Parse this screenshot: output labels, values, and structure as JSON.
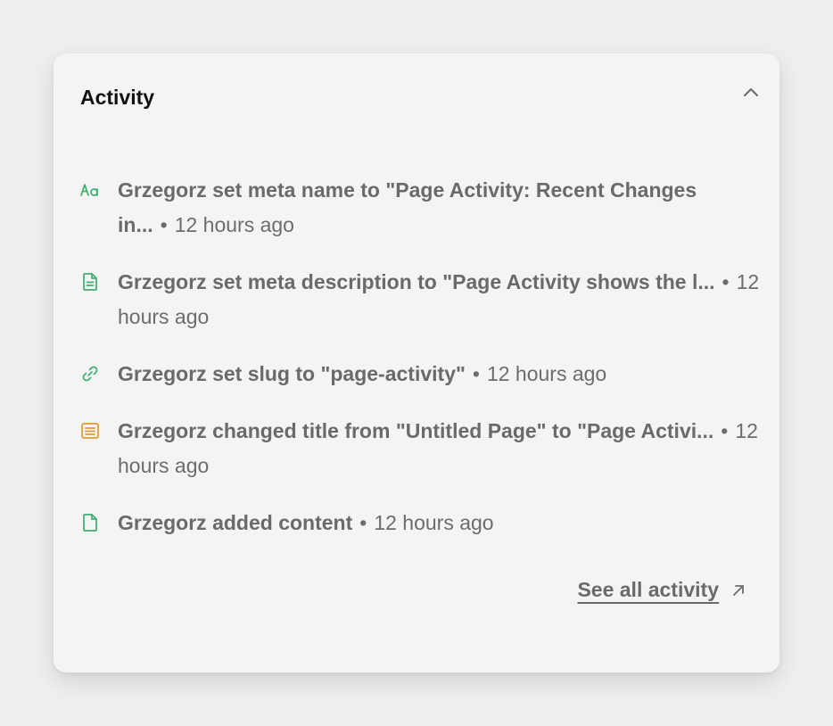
{
  "panel": {
    "title": "Activity",
    "collapse_icon": "chevron-up-icon"
  },
  "activities": [
    {
      "icon": "text-format-icon",
      "icon_color": "#3fae6f",
      "text": "Grzegorz set meta name to \"Page Activity: Recent Changes in...",
      "time": "12 hours ago"
    },
    {
      "icon": "document-lines-icon",
      "icon_color": "#3fae6f",
      "text": "Grzegorz set meta description to \"Page Activity shows the l...",
      "time": "12 hours ago"
    },
    {
      "icon": "link-icon",
      "icon_color": "#3fae6f",
      "text": "Grzegorz set slug to \"page-activity\"",
      "time": "12 hours ago"
    },
    {
      "icon": "title-list-icon",
      "icon_color": "#e09a2b",
      "text": "Grzegorz changed title from \"Untitled Page\" to \"Page Activi...",
      "time": "12 hours ago"
    },
    {
      "icon": "document-icon",
      "icon_color": "#3fae6f",
      "text": "Grzegorz added content",
      "time": "12 hours ago"
    }
  ],
  "footer": {
    "see_all_label": "See all activity",
    "see_all_icon": "arrow-up-right-icon"
  }
}
